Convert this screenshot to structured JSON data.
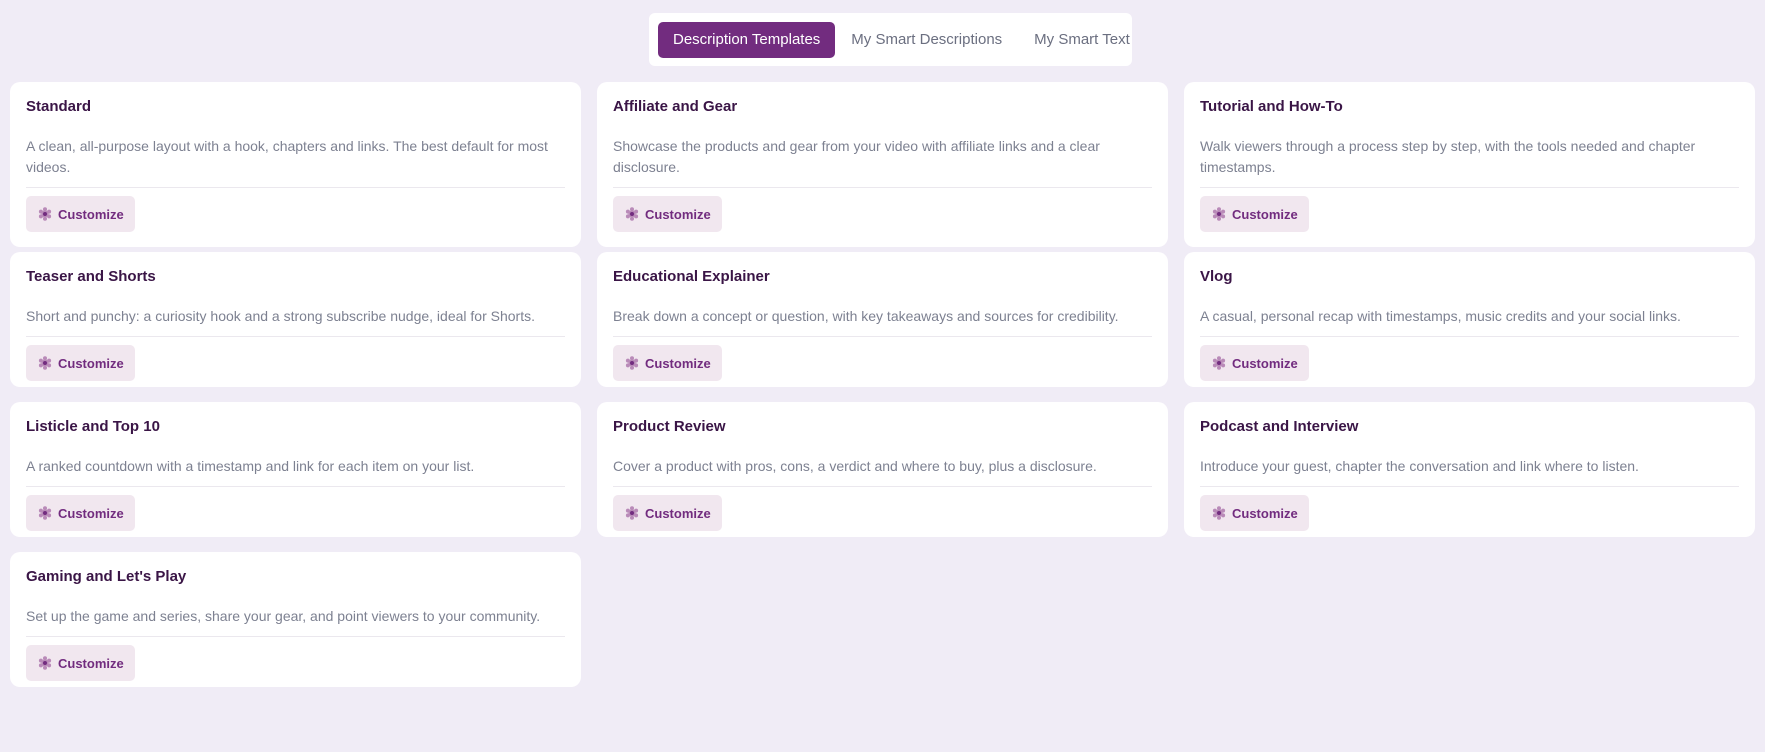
{
  "tabs": [
    {
      "label": "Description Templates",
      "active": true
    },
    {
      "label": "My Smart Descriptions",
      "active": false
    },
    {
      "label": "My Smart Text",
      "active": false
    }
  ],
  "colors": {
    "accent": "#722c7f",
    "background": "#f0ecf6",
    "button_bg": "#f1e7ef",
    "title": "#3a1546",
    "body_text": "#7d8191"
  },
  "button_icon": "gear-icon",
  "cards": [
    {
      "title": "Standard",
      "description": "A clean, all-purpose layout with a hook, chapters and links. The best default for most videos.",
      "button": "Customize"
    },
    {
      "title": "Affiliate and Gear",
      "description": "Showcase the products and gear from your video with affiliate links and a clear disclosure.",
      "button": "Customize"
    },
    {
      "title": "Tutorial and How-To",
      "description": "Walk viewers through a process step by step, with the tools needed and chapter timestamps.",
      "button": "Customize"
    },
    {
      "title": "Teaser and Shorts",
      "description": "Short and punchy: a curiosity hook and a strong subscribe nudge, ideal for Shorts.",
      "button": "Customize"
    },
    {
      "title": "Educational Explainer",
      "description": "Break down a concept or question, with key takeaways and sources for credibility.",
      "button": "Customize"
    },
    {
      "title": "Vlog",
      "description": "A casual, personal recap with timestamps, music credits and your social links.",
      "button": "Customize"
    },
    {
      "title": "Listicle and Top 10",
      "description": "A ranked countdown with a timestamp and link for each item on your list.",
      "button": "Customize"
    },
    {
      "title": "Product Review",
      "description": "Cover a product with pros, cons, a verdict and where to buy, plus a disclosure.",
      "button": "Customize"
    },
    {
      "title": "Podcast and Interview",
      "description": "Introduce your guest, chapter the conversation and link where to listen.",
      "button": "Customize"
    },
    {
      "title": "Gaming and Let's Play",
      "description": "Set up the game and series, share your gear, and point viewers to your community.",
      "button": "Customize"
    }
  ]
}
